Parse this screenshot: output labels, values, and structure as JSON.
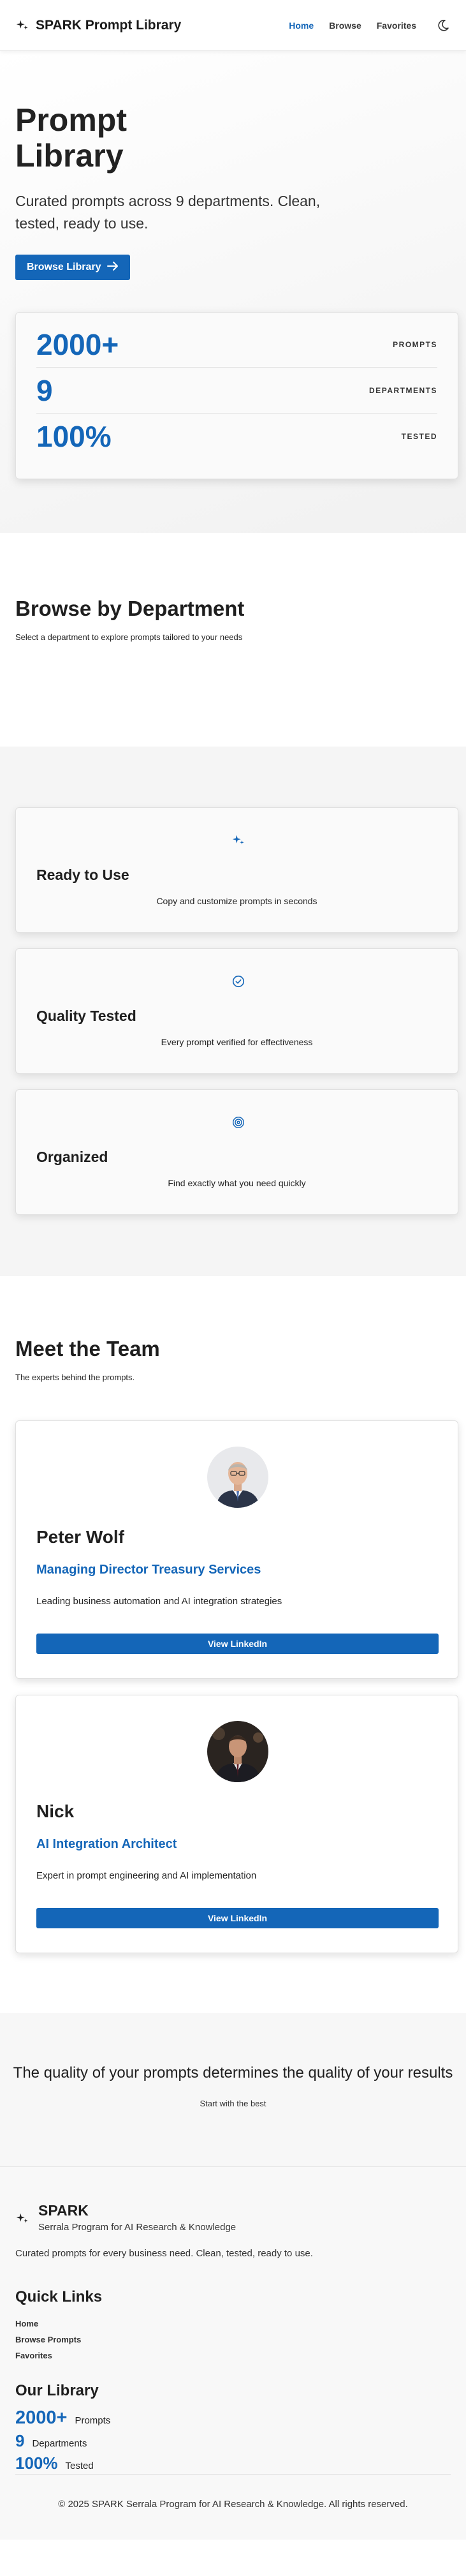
{
  "header": {
    "brand": "SPARK Prompt Library",
    "brand_icon": "sparkle-icon",
    "nav": [
      {
        "label": "Home",
        "active": true
      },
      {
        "label": "Browse",
        "active": false
      },
      {
        "label": "Favorites",
        "active": false
      }
    ],
    "theme_icon": "moon-icon"
  },
  "hero": {
    "title": "Prompt Library",
    "subtitle": "Curated prompts across 9 departments. Clean, tested, ready to use.",
    "cta_label": "Browse Library",
    "cta_icon": "arrow-right-icon",
    "stats": [
      {
        "value": "2000+",
        "label": "PROMPTS"
      },
      {
        "value": "9",
        "label": "DEPARTMENTS"
      },
      {
        "value": "100%",
        "label": "TESTED"
      }
    ]
  },
  "departments": {
    "title": "Browse by Department",
    "subtitle": "Select a department to explore prompts tailored to your needs"
  },
  "features": [
    {
      "icon": "sparkle-icon",
      "title": "Ready to Use",
      "desc": "Copy and customize prompts in seconds"
    },
    {
      "icon": "check-circle-icon",
      "title": "Quality Tested",
      "desc": "Every prompt verified for effectiveness"
    },
    {
      "icon": "target-icon",
      "title": "Organized",
      "desc": "Find exactly what you need quickly"
    }
  ],
  "team": {
    "title": "Meet the Team",
    "subtitle": "The experts behind the prompts.",
    "members": [
      {
        "name": "Peter Wolf",
        "role": "Managing Director Treasury Services",
        "bio": "Leading business automation and AI integration strategies",
        "button": "View LinkedIn"
      },
      {
        "name": "Nick",
        "role": "AI Integration Architect",
        "bio": "Expert in prompt engineering and AI implementation",
        "button": "View LinkedIn"
      }
    ]
  },
  "quote": {
    "text": "The quality of your prompts determines the quality of your results",
    "sub": "Start with the best"
  },
  "footer": {
    "brand": "SPARK",
    "full_name": "Serrala Program for AI Research & Knowledge",
    "tagline": "Curated prompts for every business need. Clean, tested, ready to use.",
    "quick_links_title": "Quick Links",
    "quick_links": [
      "Home",
      "Browse Prompts",
      "Favorites"
    ],
    "library_title": "Our Library",
    "library": [
      {
        "value": "2000+",
        "label": "Prompts"
      },
      {
        "value": "9",
        "label": "Departments"
      },
      {
        "value": "100%",
        "label": "Tested"
      }
    ],
    "copyright": "© 2025 SPARK Serrala Program for AI Research & Knowledge. All rights reserved."
  },
  "colors": {
    "accent": "#1466b8",
    "text": "#1f1f1f"
  }
}
